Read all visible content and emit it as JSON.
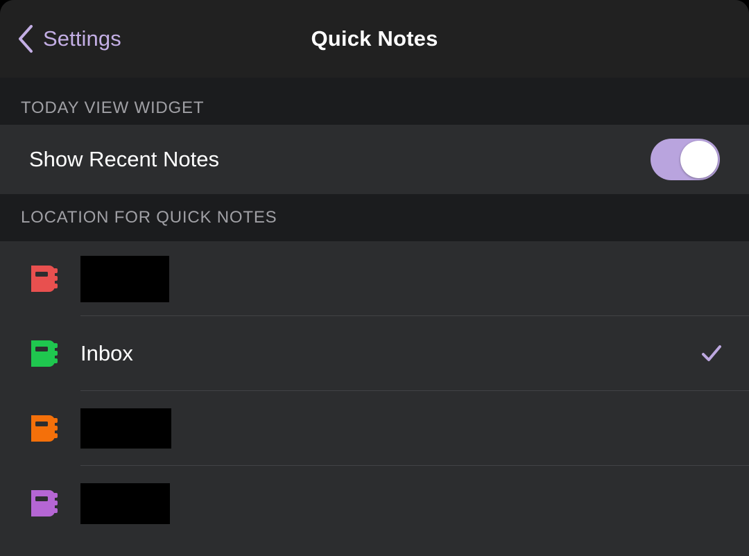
{
  "nav": {
    "back_label": "Settings",
    "back_icon": "chevron-left-icon",
    "title": "Quick Notes"
  },
  "sections": [
    {
      "header": "TODAY VIEW WIDGET",
      "rows": [
        {
          "label": "Show Recent Notes",
          "control": "toggle",
          "toggle_on": true
        }
      ]
    },
    {
      "header": "LOCATION FOR QUICK NOTES",
      "rows": [
        {
          "icon": "notebook-icon",
          "icon_color": "#e8504f",
          "label": "",
          "redacted": true,
          "redaction_width": 128,
          "redaction_height": 67,
          "selected": false
        },
        {
          "icon": "notebook-icon",
          "icon_color": "#1fc74f",
          "label": "Inbox",
          "redacted": false,
          "selected": true
        },
        {
          "icon": "notebook-icon",
          "icon_color": "#f4700a",
          "label": "",
          "redacted": true,
          "redaction_width": 131,
          "redaction_height": 58,
          "selected": false
        },
        {
          "icon": "notebook-icon",
          "icon_color": "#b566d4",
          "label": "",
          "redacted": true,
          "redaction_width": 129,
          "redaction_height": 59,
          "selected": false
        }
      ]
    }
  ],
  "colors": {
    "accent": "#c3aee4",
    "toggle_on_track": "#b9a4de",
    "toggle_knob": "#ffffff",
    "checkmark": "#bda8e0",
    "navbar_bg": "#212121",
    "page_bg": "#1b1c1e",
    "row_bg": "#2c2d2f",
    "separator": "#424346",
    "section_header_text": "#a0a0a5",
    "primary_text": "#ffffff"
  }
}
